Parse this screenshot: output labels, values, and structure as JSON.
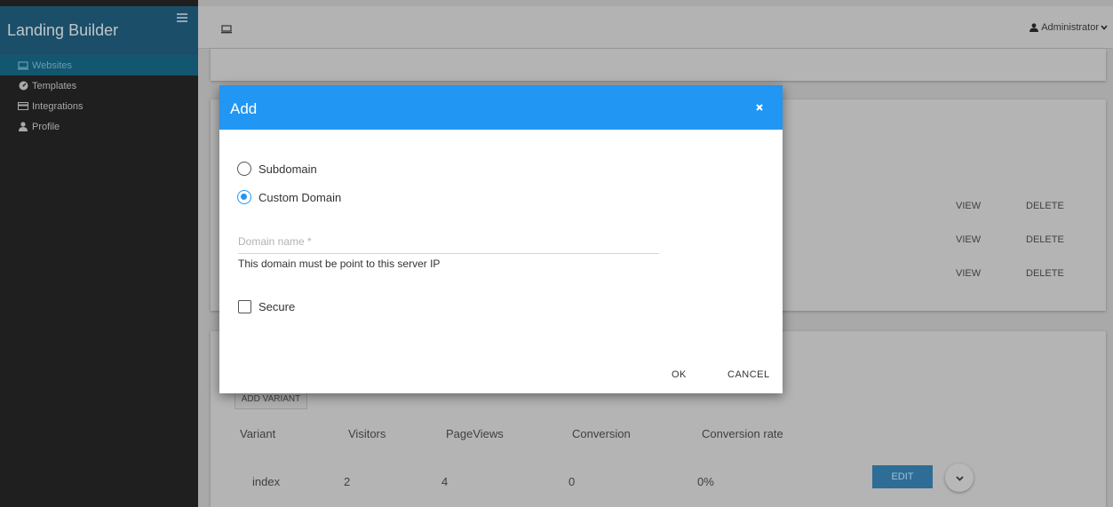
{
  "sidebar": {
    "brand": "Landing Builder",
    "items": [
      {
        "label": "Websites",
        "icon": "monitor-icon",
        "active": true
      },
      {
        "label": "Templates",
        "icon": "dashboard-icon",
        "active": false
      },
      {
        "label": "Integrations",
        "icon": "card-icon",
        "active": false
      },
      {
        "label": "Profile",
        "icon": "user-icon",
        "active": false
      }
    ]
  },
  "topbar": {
    "user_label": "Administrator"
  },
  "websites_list": {
    "rows": [
      {
        "view_label": "VIEW",
        "delete_label": "DELETE"
      },
      {
        "view_label": "VIEW",
        "delete_label": "DELETE"
      },
      {
        "view_label": "VIEW",
        "delete_label": "DELETE"
      }
    ]
  },
  "variants": {
    "add_label": "ADD VARIANT",
    "columns": [
      "Variant",
      "Visitors",
      "PageViews",
      "Conversion",
      "Conversion rate"
    ],
    "rows": [
      {
        "variant": "index",
        "visitors": "2",
        "pageviews": "4",
        "conversion": "0",
        "rate": "0%"
      }
    ],
    "edit_label": "EDIT"
  },
  "modal": {
    "title": "Add",
    "options": [
      {
        "label": "Subdomain",
        "selected": false
      },
      {
        "label": "Custom Domain",
        "selected": true
      }
    ],
    "domain_placeholder": "Domain name *",
    "domain_value": "",
    "help_text": "This domain must be point to this server IP",
    "secure_label": "Secure",
    "secure_checked": false,
    "ok_label": "OK",
    "cancel_label": "CANCEL"
  },
  "colors": {
    "accent": "#2196f3",
    "sidebar_bg": "#1f1f1f",
    "edit_button": "#2e6d95"
  }
}
